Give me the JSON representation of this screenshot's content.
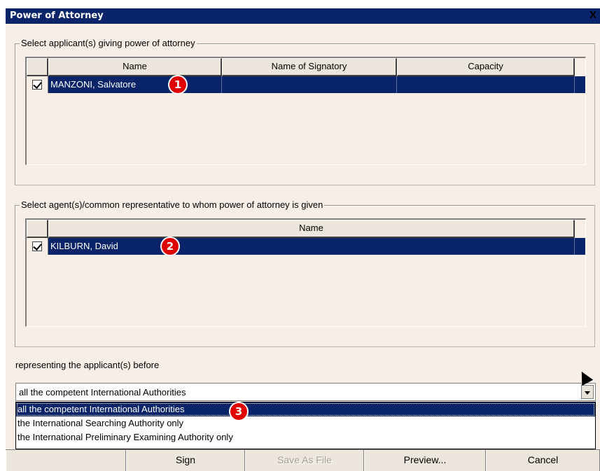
{
  "window": {
    "title": "Power of Attorney",
    "close_glyph": "X"
  },
  "applicants_group": {
    "legend": "Select applicant(s) giving power of attorney",
    "columns": [
      "Name",
      "Name of Signatory",
      "Capacity"
    ],
    "rows": [
      {
        "checked": true,
        "name": "MANZONI, Salvatore",
        "signatory": "",
        "capacity": ""
      }
    ],
    "badge": "1"
  },
  "agents_group": {
    "legend": "Select agent(s)/common representative to whom power of attorney is given",
    "columns": [
      "Name"
    ],
    "rows": [
      {
        "checked": true,
        "name": "KILBURN, David"
      }
    ],
    "badge": "2"
  },
  "representing": {
    "label": "representing the applicant(s) before",
    "selected": "all the competent International Authorities",
    "options": [
      "all the competent International Authorities",
      "the International Searching Authority only",
      "the International Preliminary Examining Authority only"
    ],
    "badge": "3"
  },
  "buttons": {
    "sign": "Sign",
    "save": "Save As File",
    "preview": "Preview...",
    "cancel": "Cancel"
  },
  "colors": {
    "selection": "#0a246a",
    "dialog_bg": "#f6eee7",
    "badge": "#e00000"
  }
}
